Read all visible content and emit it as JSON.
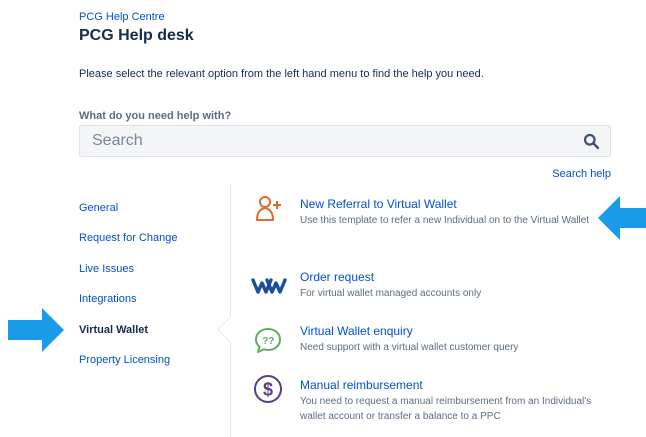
{
  "breadcrumb": "PCG Help Centre",
  "title": "PCG Help desk",
  "intro": "Please select the relevant option from the left hand menu to find the help you need.",
  "search": {
    "label": "What do you need help with?",
    "placeholder": "Search",
    "help_link": "Search help"
  },
  "menu": {
    "items": [
      {
        "label": "General"
      },
      {
        "label": "Request for Change"
      },
      {
        "label": "Live Issues"
      },
      {
        "label": "Integrations"
      },
      {
        "label": "Virtual Wallet",
        "selected": true
      },
      {
        "label": "Property Licensing"
      }
    ]
  },
  "request_types": [
    {
      "icon": "add-person-icon",
      "title": "New Referral to Virtual Wallet",
      "description": "Use this template to refer a new Individual on to the Virtual Wallet"
    },
    {
      "icon": "vw-logo-icon",
      "title": "Order request",
      "description": "For virtual wallet managed accounts only"
    },
    {
      "icon": "question-bubble-icon",
      "title": "Virtual Wallet enquiry",
      "description": "Need support with a virtual wallet customer query"
    },
    {
      "icon": "dollar-icon",
      "title": "Manual reimbursement",
      "description": "You need to request a manual reimbursement from an Individual's wallet account or transfer a balance to a PPC"
    }
  ],
  "colors": {
    "link": "#0052cc",
    "text": "#172b4d",
    "subtle_text": "#5e6c84",
    "annotation_arrow": "#1a9be8",
    "referral_icon": "#e06b2c",
    "order_icon": "#1a4fa0",
    "enquiry_icon": "#5fae5b",
    "reimbursement_icon": "#5a3e85"
  }
}
